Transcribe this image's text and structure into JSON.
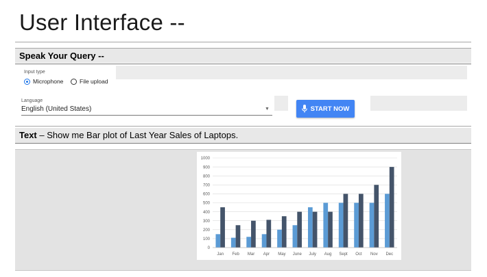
{
  "page": {
    "title": "User Interface --"
  },
  "query_section": {
    "title": "Speak Your Query --"
  },
  "input_type": {
    "label": "Input type",
    "options": [
      "Microphone",
      "File upload"
    ],
    "selected": "Microphone"
  },
  "language": {
    "label": "Language",
    "value": "English (United States)"
  },
  "start_button": {
    "label": "START NOW",
    "color": "#4285f4"
  },
  "text_query": {
    "prefix": "Text",
    "separator": " – ",
    "content": "Show me Bar plot of Last Year Sales of Laptops."
  },
  "icons": {
    "microphone": "microphone-icon",
    "dropdown": "chevron-down-icon"
  },
  "chart_data": {
    "type": "bar",
    "categories": [
      "Jan",
      "Feb",
      "Mar",
      "Apr",
      "May",
      "June",
      "July",
      "Aug",
      "Sept",
      "Oct",
      "Nov",
      "Dec"
    ],
    "series": [
      {
        "color": "#5b9bd5",
        "values": [
          150,
          110,
          120,
          150,
          200,
          250,
          450,
          500,
          500,
          500,
          500,
          600
        ]
      },
      {
        "color": "#44546a",
        "values": [
          450,
          250,
          300,
          310,
          350,
          400,
          400,
          400,
          600,
          600,
          700,
          900
        ]
      }
    ],
    "ylim": [
      0,
      1000
    ],
    "yticks": [
      0,
      100,
      200,
      300,
      400,
      500,
      600,
      700,
      800,
      900,
      1000
    ],
    "grid": true
  }
}
